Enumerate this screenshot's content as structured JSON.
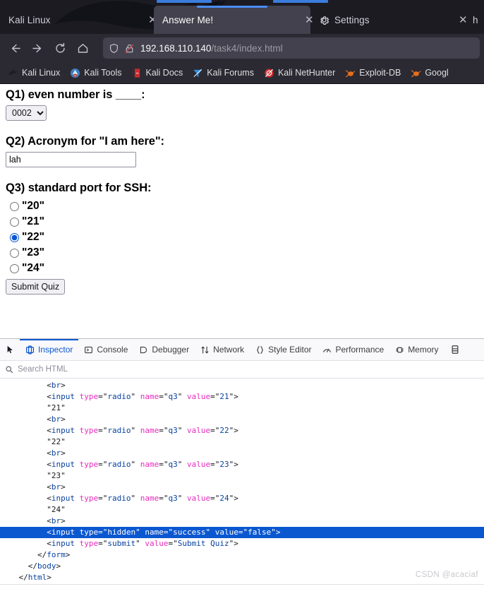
{
  "browser": {
    "tabs": [
      {
        "title": "Kali Linux",
        "icon": "none",
        "state": "loading-indicator",
        "close": "✕"
      },
      {
        "title": "Answer Me!",
        "icon": "none",
        "state": "active",
        "close": "✕"
      },
      {
        "title": "Settings",
        "icon": "gear-icon",
        "state": "loading-indicator",
        "close": "✕"
      },
      {
        "title": "h",
        "icon": "none",
        "state": "inactive",
        "close": ""
      }
    ],
    "nav": {
      "back": "←",
      "forward": "→",
      "reload": "⟳",
      "home": "⌂"
    },
    "url": {
      "host": "192.168.110.140",
      "path": "/task4/index.html",
      "shield_icon": "shield-icon",
      "lock_icon": "lock-crossed-icon"
    },
    "bookmarks": [
      {
        "label": "Kali Linux",
        "icon": "kali-dragon-icon"
      },
      {
        "label": "Kali Tools",
        "icon": "kali-tools-icon"
      },
      {
        "label": "Kali Docs",
        "icon": "kali-docs-icon"
      },
      {
        "label": "Kali Forums",
        "icon": "kali-forums-icon"
      },
      {
        "label": "Kali NetHunter",
        "icon": "kali-nethunter-icon"
      },
      {
        "label": "Exploit-DB",
        "icon": "exploit-db-icon"
      },
      {
        "label": "Googl",
        "icon": "google-hacking-icon"
      }
    ]
  },
  "page": {
    "q1": {
      "label": "Q1) even number is ____:",
      "select_value": "0002",
      "options": [
        "0002"
      ]
    },
    "q2": {
      "label": "Q2) Acronym for \"I am here\":",
      "input_value": "lah",
      "placeholder": ""
    },
    "q3": {
      "label": "Q3) standard port for SSH:",
      "options": [
        {
          "label": "\"20\"",
          "value": "20",
          "checked": false
        },
        {
          "label": "\"21\"",
          "value": "21",
          "checked": false
        },
        {
          "label": "\"22\"",
          "value": "22",
          "checked": true
        },
        {
          "label": "\"23\"",
          "value": "23",
          "checked": false
        },
        {
          "label": "\"24\"",
          "value": "24",
          "checked": false
        }
      ]
    },
    "submit_label": "Submit Quiz"
  },
  "devtools": {
    "picker_icon": "element-picker-icon",
    "tabs": [
      {
        "label": "Inspector",
        "icon": "inspector-icon",
        "selected": true
      },
      {
        "label": "Console",
        "icon": "console-icon",
        "selected": false
      },
      {
        "label": "Debugger",
        "icon": "debugger-icon",
        "selected": false
      },
      {
        "label": "Network",
        "icon": "network-icon",
        "selected": false
      },
      {
        "label": "Style Editor",
        "icon": "style-editor-icon",
        "selected": false
      },
      {
        "label": "Performance",
        "icon": "performance-icon",
        "selected": false
      },
      {
        "label": "Memory",
        "icon": "memory-icon",
        "selected": false
      }
    ],
    "overflow_icon": "storage-icon",
    "search_placeholder": "Search HTML",
    "search_icon": "search-icon",
    "code_lines": [
      {
        "indent": 3,
        "type": "tag",
        "text": "<br>",
        "selected": false
      },
      {
        "indent": 3,
        "type": "input",
        "tag": "input",
        "attrs": [
          [
            "type",
            "radio"
          ],
          [
            "name",
            "q3"
          ],
          [
            "value",
            "21"
          ]
        ],
        "selected": false
      },
      {
        "indent": 3,
        "type": "text",
        "text": "\"21\"",
        "selected": false
      },
      {
        "indent": 3,
        "type": "tag",
        "text": "<br>",
        "selected": false
      },
      {
        "indent": 3,
        "type": "input",
        "tag": "input",
        "attrs": [
          [
            "type",
            "radio"
          ],
          [
            "name",
            "q3"
          ],
          [
            "value",
            "22"
          ]
        ],
        "selected": false
      },
      {
        "indent": 3,
        "type": "text",
        "text": "\"22\"",
        "selected": false
      },
      {
        "indent": 3,
        "type": "tag",
        "text": "<br>",
        "selected": false
      },
      {
        "indent": 3,
        "type": "input",
        "tag": "input",
        "attrs": [
          [
            "type",
            "radio"
          ],
          [
            "name",
            "q3"
          ],
          [
            "value",
            "23"
          ]
        ],
        "selected": false
      },
      {
        "indent": 3,
        "type": "text",
        "text": "\"23\"",
        "selected": false
      },
      {
        "indent": 3,
        "type": "tag",
        "text": "<br>",
        "selected": false
      },
      {
        "indent": 3,
        "type": "input",
        "tag": "input",
        "attrs": [
          [
            "type",
            "radio"
          ],
          [
            "name",
            "q3"
          ],
          [
            "value",
            "24"
          ]
        ],
        "selected": false
      },
      {
        "indent": 3,
        "type": "text",
        "text": "\"24\"",
        "selected": false
      },
      {
        "indent": 3,
        "type": "tag",
        "text": "<br>",
        "selected": false
      },
      {
        "indent": 3,
        "type": "input",
        "tag": "input",
        "attrs": [
          [
            "type",
            "hidden"
          ],
          [
            "name",
            "success"
          ],
          [
            "value",
            "false"
          ]
        ],
        "selected": true
      },
      {
        "indent": 3,
        "type": "input",
        "tag": "input",
        "attrs": [
          [
            "type",
            "submit"
          ],
          [
            "value",
            "Submit Quiz"
          ]
        ],
        "selected": false
      },
      {
        "indent": 2,
        "type": "close",
        "text": "</form>",
        "selected": false
      },
      {
        "indent": 1,
        "type": "close",
        "text": "</body>",
        "selected": false
      },
      {
        "indent": 0,
        "type": "close",
        "text": "</html>",
        "selected": false
      }
    ]
  },
  "watermark": "CSDN @acaciaf"
}
